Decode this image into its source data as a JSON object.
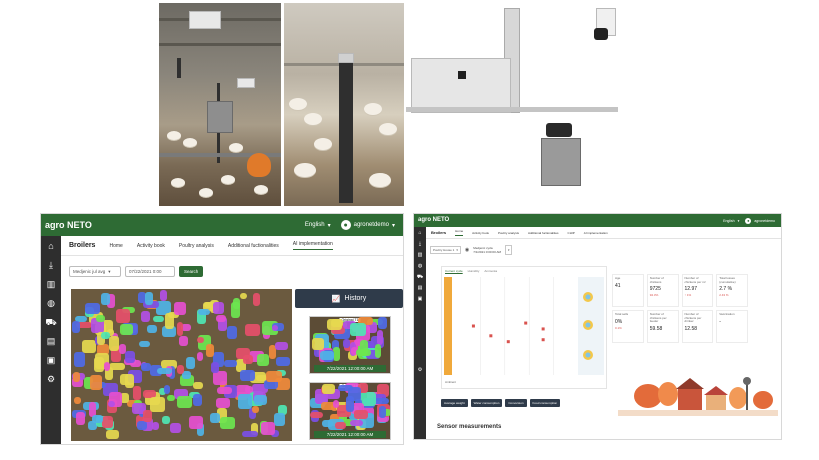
{
  "photos": {
    "left_caption": "",
    "middle_caption": "",
    "right_caption": ""
  },
  "left_app": {
    "logo": "agro NETO",
    "language": "English",
    "user": "agronetdemo",
    "brand_tab": "Broilers",
    "tabs": [
      "Home",
      "Activity book",
      "Poultry analysis",
      "Additional fuctionalities",
      "AI implementation"
    ],
    "active_tab": "AI implementation",
    "filter_select": "Medjenic jul avg",
    "filter_date": "07/22/2021 0:00",
    "search_label": "Search",
    "history_label": "History",
    "thumbs": [
      {
        "tag": "Original",
        "tag_suffix": "T1",
        "stamp": "7/22/2021 12:00:00 AM"
      },
      {
        "tag": "Original",
        "tag_suffix": "T2",
        "stamp": "7/22/2021 12:00:00 AM"
      }
    ],
    "sidebar_icons": [
      "home-icon",
      "download-icon",
      "building-icon",
      "globe-icon",
      "tractor-icon",
      "chart-icon",
      "report-icon",
      "settings-icon"
    ]
  },
  "right_app": {
    "logo": "agro NETO",
    "language": "English",
    "user": "agronetdemo",
    "brand_tab": "Broilers",
    "tabs": [
      "Home",
      "Activity book",
      "Poultry analysis",
      "Additional fuctionalities",
      "CHIP",
      "AI implementation"
    ],
    "active_tab": "Home",
    "filter_select": "Poultry House 1",
    "location_lines": [
      "Medjenic cycle",
      "7/1/2021 0:00:00 AM"
    ],
    "chart_tabs": [
      "Current cycle",
      "Humidity",
      "Ammonia"
    ],
    "chart_footer": "Ambient",
    "buttons": [
      "Average weight",
      "Water consumption",
      "Conversion",
      "Food consumption"
    ],
    "stats": [
      {
        "label": "Age",
        "value": "41",
        "sub": ""
      },
      {
        "label": "Number of chickens",
        "value": "9725",
        "sub": "94.3%"
      },
      {
        "label": "Number of chickens per m²",
        "value": "12.97",
        "sub": "↑ 1%"
      },
      {
        "label": "Total losses (cumulative)",
        "value": "2.7 %",
        "sub": "2.43 %"
      },
      {
        "label": "Total sells",
        "value": "0%",
        "sub": "0.1%"
      },
      {
        "label": "Number of chickens per feeder",
        "value": "59.58",
        "sub": ""
      },
      {
        "label": "Number of chickens per drinker",
        "value": "12.58",
        "sub": ""
      },
      {
        "label": "Vaccination",
        "value": "-",
        "sub": ""
      }
    ],
    "sensor_title": "Sensor measurements",
    "colors": {
      "green": "#2e6b34",
      "dark": "#2f3b4a",
      "orange": "#f0a93b",
      "red_marker": "#d9534f"
    }
  },
  "chart_data": {
    "type": "scatter",
    "title": "",
    "xlabel": "",
    "ylabel": "",
    "series": [
      {
        "name": "",
        "points": [
          [
            1,
            5
          ],
          [
            2,
            4
          ],
          [
            3,
            3.4
          ],
          [
            4,
            5.3
          ],
          [
            5,
            3.6
          ],
          [
            5,
            4.7
          ]
        ]
      }
    ],
    "xlim": [
      0,
      7
    ],
    "ylim": [
      0,
      10
    ]
  }
}
